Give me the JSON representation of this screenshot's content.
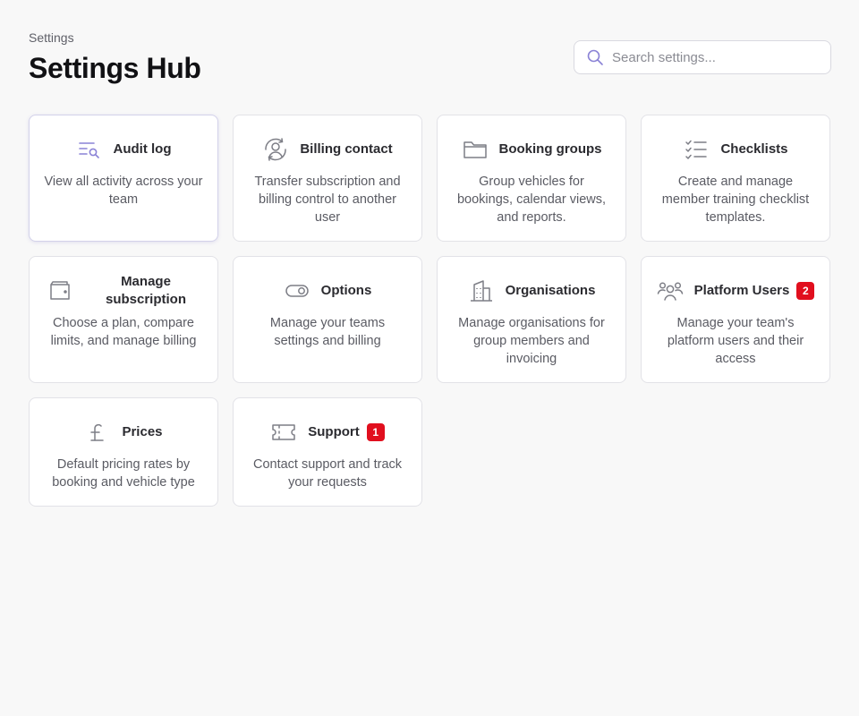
{
  "header": {
    "breadcrumb": "Settings",
    "title": "Settings Hub"
  },
  "search": {
    "placeholder": "Search settings...",
    "value": ""
  },
  "colors": {
    "accent": "#8a82d6",
    "badge": "#e10f1e",
    "icon": "#7d7e86"
  },
  "cards": [
    {
      "id": "audit-log",
      "icon": "list-search-icon",
      "title": "Audit log",
      "desc": "View all activity across your team",
      "badge": null
    },
    {
      "id": "billing-contact",
      "icon": "user-transfer-icon",
      "title": "Billing contact",
      "desc": "Transfer subscription and billing control to another user",
      "badge": null
    },
    {
      "id": "booking-groups",
      "icon": "folder-icon",
      "title": "Booking groups",
      "desc": "Group vehicles for bookings, calendar views, and reports.",
      "badge": null
    },
    {
      "id": "checklists",
      "icon": "checklist-icon",
      "title": "Checklists",
      "desc": "Create and manage member training checklist templates.",
      "badge": null
    },
    {
      "id": "manage-subscription",
      "icon": "wallet-icon",
      "title": "Manage subscription",
      "desc": "Choose a plan, compare limits, and manage billing",
      "badge": null
    },
    {
      "id": "options",
      "icon": "toggle-icon",
      "title": "Options",
      "desc": "Manage your teams settings and billing",
      "badge": null
    },
    {
      "id": "organisations",
      "icon": "building-icon",
      "title": "Organisations",
      "desc": "Manage organisations for group members and invoicing",
      "badge": null
    },
    {
      "id": "platform-users",
      "icon": "users-icon",
      "title": "Platform Users",
      "desc": "Manage your team's platform users and their access",
      "badge": "2"
    },
    {
      "id": "prices",
      "icon": "pound-icon",
      "title": "Prices",
      "desc": "Default pricing rates by booking and vehicle type",
      "badge": null
    },
    {
      "id": "support",
      "icon": "ticket-icon",
      "title": "Support",
      "desc": "Contact support and track your requests",
      "badge": "1"
    }
  ]
}
